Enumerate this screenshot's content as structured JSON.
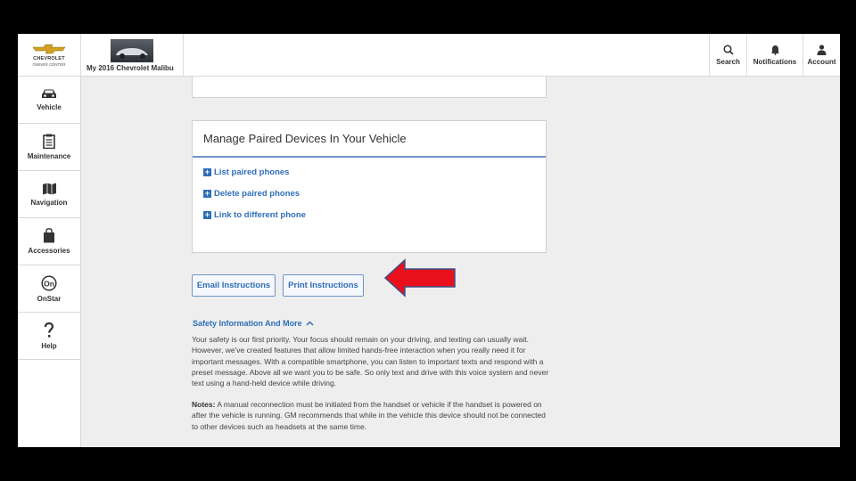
{
  "brand": {
    "name": "CHEVROLET",
    "sub": "OWNER CENTER",
    "gold": "#d3a21f"
  },
  "vehicle": {
    "label": "My 2016 Chevrolet Malibu"
  },
  "toolbar": {
    "search": "Search",
    "notifications": "Notifications",
    "account": "Account"
  },
  "sidebar": {
    "items": [
      {
        "label": "Vehicle",
        "icon": "car-icon"
      },
      {
        "label": "Maintenance",
        "icon": "clipboard-icon"
      },
      {
        "label": "Navigation",
        "icon": "map-icon"
      },
      {
        "label": "Accessories",
        "icon": "bag-icon"
      },
      {
        "label": "OnStar",
        "icon": "onstar-icon"
      },
      {
        "label": "Help",
        "icon": "question-icon"
      }
    ]
  },
  "devices": {
    "title": "Manage Paired Devices In Your Vehicle",
    "links": [
      "List paired phones",
      "Delete paired phones",
      "Link to different phone"
    ]
  },
  "buttons": {
    "email": "Email Instructions",
    "print": "Print Instructions"
  },
  "safety": {
    "heading": "Safety Information And More",
    "body": "Your safety is our first priority. Your focus should remain on your driving, and texting can usually wait. However, we've created features that allow limited hands-free interaction when you really need it for important messages. With a compatible smartphone, you can listen to important texts and respond with a preset message. Above all we want you to be safe. So only text and drive with this voice system and never text using a hand-held device while driving.",
    "notes_label": "Notes:",
    "notes_body": " A manual reconnection must be initiated from the handset or vehicle if the handset is powered on after the vehicle is running. GM recommends that while in the vehicle this device should not be connected to other devices such as headsets at the same time."
  },
  "colors": {
    "accent": "#2f6fb8",
    "arrow": "#e8111b"
  }
}
